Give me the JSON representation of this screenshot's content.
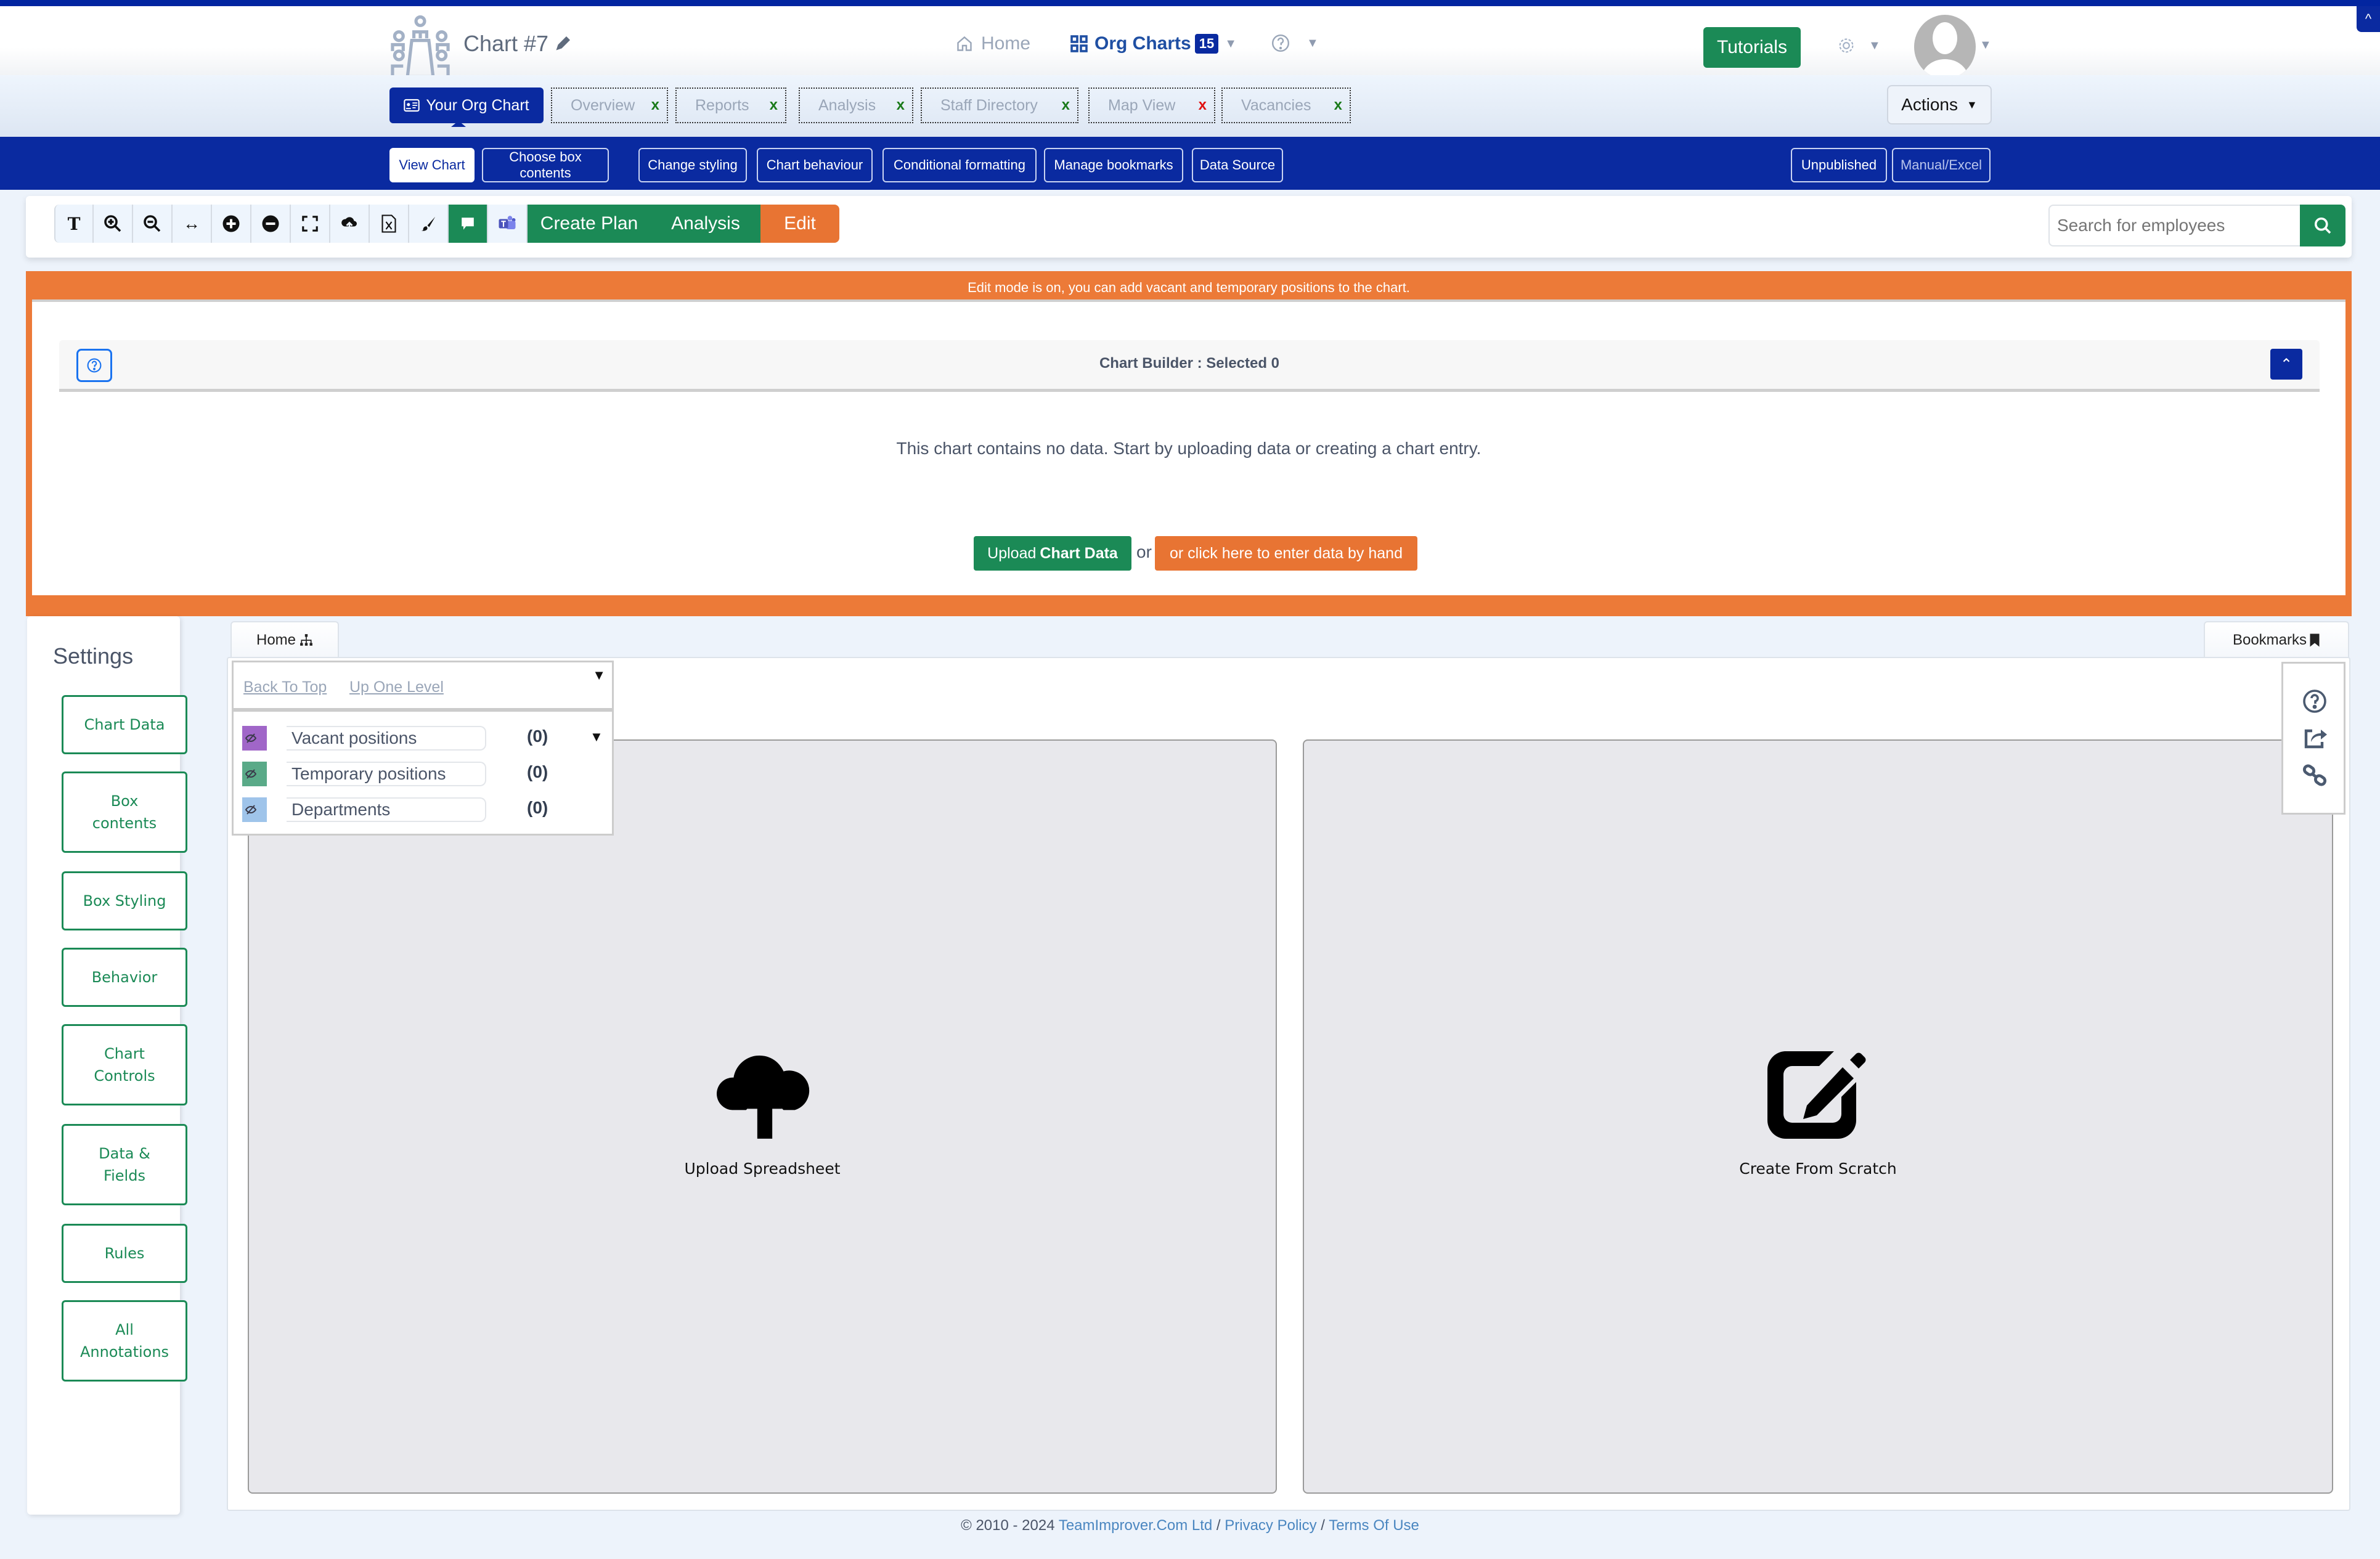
{
  "header": {
    "chart_title": "Chart #7",
    "nav": {
      "home": "Home",
      "org_charts": "Org Charts",
      "org_charts_count": "15"
    },
    "tutorials_label": "Tutorials",
    "scroll_top": "^"
  },
  "tabs": {
    "active": "Your Org Chart",
    "items": [
      {
        "label": "Overview",
        "close": "x",
        "close_color": "green"
      },
      {
        "label": "Reports",
        "close": "x",
        "close_color": "green"
      },
      {
        "label": "Analysis",
        "close": "x",
        "close_color": "green"
      },
      {
        "label": "Staff Directory",
        "close": "x",
        "close_color": "green"
      },
      {
        "label": "Map View",
        "close": "x",
        "close_color": "red"
      },
      {
        "label": "Vacancies",
        "close": "x",
        "close_color": "green"
      }
    ],
    "actions_label": "Actions"
  },
  "subnav": {
    "items": [
      "View Chart",
      "Choose box contents",
      "Change styling",
      "Chart behaviour",
      "Conditional formatting",
      "Manage bookmarks",
      "Data Source"
    ],
    "active_index": 0,
    "status": [
      "Unpublished",
      "Manual/Excel"
    ]
  },
  "toolbar": {
    "tools": [
      "text-size",
      "zoom-in",
      "zoom-out",
      "fit-width",
      "expand-all",
      "collapse-all",
      "fullscreen",
      "upload",
      "export-excel",
      "brush",
      "comment",
      "teams"
    ],
    "create_plan": "Create Plan",
    "analysis": "Analysis",
    "edit": "Edit",
    "search_placeholder": "Search for employees"
  },
  "edit_mode": {
    "message": "Edit mode is on, you can add vacant and temporary positions to the chart.",
    "builder_title": "Chart Builder : Selected 0",
    "no_data": "This chart contains no data. Start by uploading data or creating a chart entry.",
    "upload_prefix": "Upload",
    "upload_bold": "Chart Data",
    "or": "or",
    "hand_entry": "or click here to enter data by hand"
  },
  "settings": {
    "title": "Settings",
    "buttons": [
      [
        "Chart Data"
      ],
      [
        "Box",
        "contents"
      ],
      [
        "Box Styling"
      ],
      [
        "Behavior"
      ],
      [
        "Chart",
        "Controls"
      ],
      [
        "Data &",
        "Fields"
      ],
      [
        "Rules"
      ],
      [
        "All",
        "Annotations"
      ]
    ]
  },
  "canvas": {
    "home_tab": "Home",
    "bookmarks_tab": "Bookmarks",
    "nav_links": [
      "Back To Top",
      "Up One Level"
    ],
    "legend": [
      {
        "label": "Vacant positions",
        "count": "(0)",
        "color": "#a066c8"
      },
      {
        "label": "Temporary positions",
        "count": "(0)",
        "color": "#5aaa88"
      },
      {
        "label": "Departments",
        "count": "(0)",
        "color": "#9fc4ea"
      }
    ],
    "cards": [
      {
        "label": "Upload Spreadsheet",
        "icon": "cloud-upload-icon"
      },
      {
        "label": "Create From Scratch",
        "icon": "edit-square-icon"
      }
    ]
  },
  "footer": {
    "copyright": "© 2010 - 2024",
    "company": "TeamImprover.Com Ltd",
    "sep": "/",
    "privacy": "Privacy Policy",
    "terms": "Terms Of Use"
  },
  "colors": {
    "brand_blue": "#0a2aa0",
    "green": "#1b8a56",
    "orange": "#e87433"
  }
}
